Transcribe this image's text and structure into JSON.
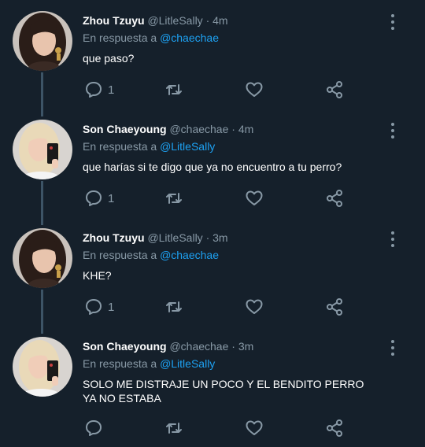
{
  "tweets": [
    {
      "display_name": "Zhou Tzuyu",
      "handle": "@LitleSally",
      "separator": "·",
      "time": "4m",
      "reply_prefix": "En respuesta a",
      "reply_mention": "@chaechae",
      "text": "que paso?",
      "reply_count": "1",
      "avatar": "dark-hair-woman-avatar"
    },
    {
      "display_name": "Son Chaeyoung",
      "handle": "@chaechae",
      "separator": "·",
      "time": "4m",
      "reply_prefix": "En respuesta a",
      "reply_mention": "@LitleSally",
      "text": "que harías si te digo que ya no encuentro a tu perro?",
      "reply_count": "1",
      "avatar": "blonde-woman-avatar"
    },
    {
      "display_name": "Zhou Tzuyu",
      "handle": "@LitleSally",
      "separator": "·",
      "time": "3m",
      "reply_prefix": "En respuesta a",
      "reply_mention": "@chaechae",
      "text": "KHE?",
      "reply_count": "1",
      "avatar": "dark-hair-woman-avatar"
    },
    {
      "display_name": "Son Chaeyoung",
      "handle": "@chaechae",
      "separator": "·",
      "time": "3m",
      "reply_prefix": "En respuesta a",
      "reply_mention": "@LitleSally",
      "text": "SOLO ME DISTRAJE UN POCO Y EL BENDITO PERRO YA NO ESTABA",
      "reply_count": "",
      "avatar": "blonde-woman-avatar"
    }
  ],
  "icons": {
    "reply": "reply-icon",
    "retweet": "retweet-icon",
    "like": "heart-icon",
    "share": "share-icon",
    "more": "more-options-icon"
  },
  "colors": {
    "background": "#15202b",
    "secondary_text": "#8899a6",
    "mention": "#1da1f2",
    "thread_line": "#3d5466"
  }
}
